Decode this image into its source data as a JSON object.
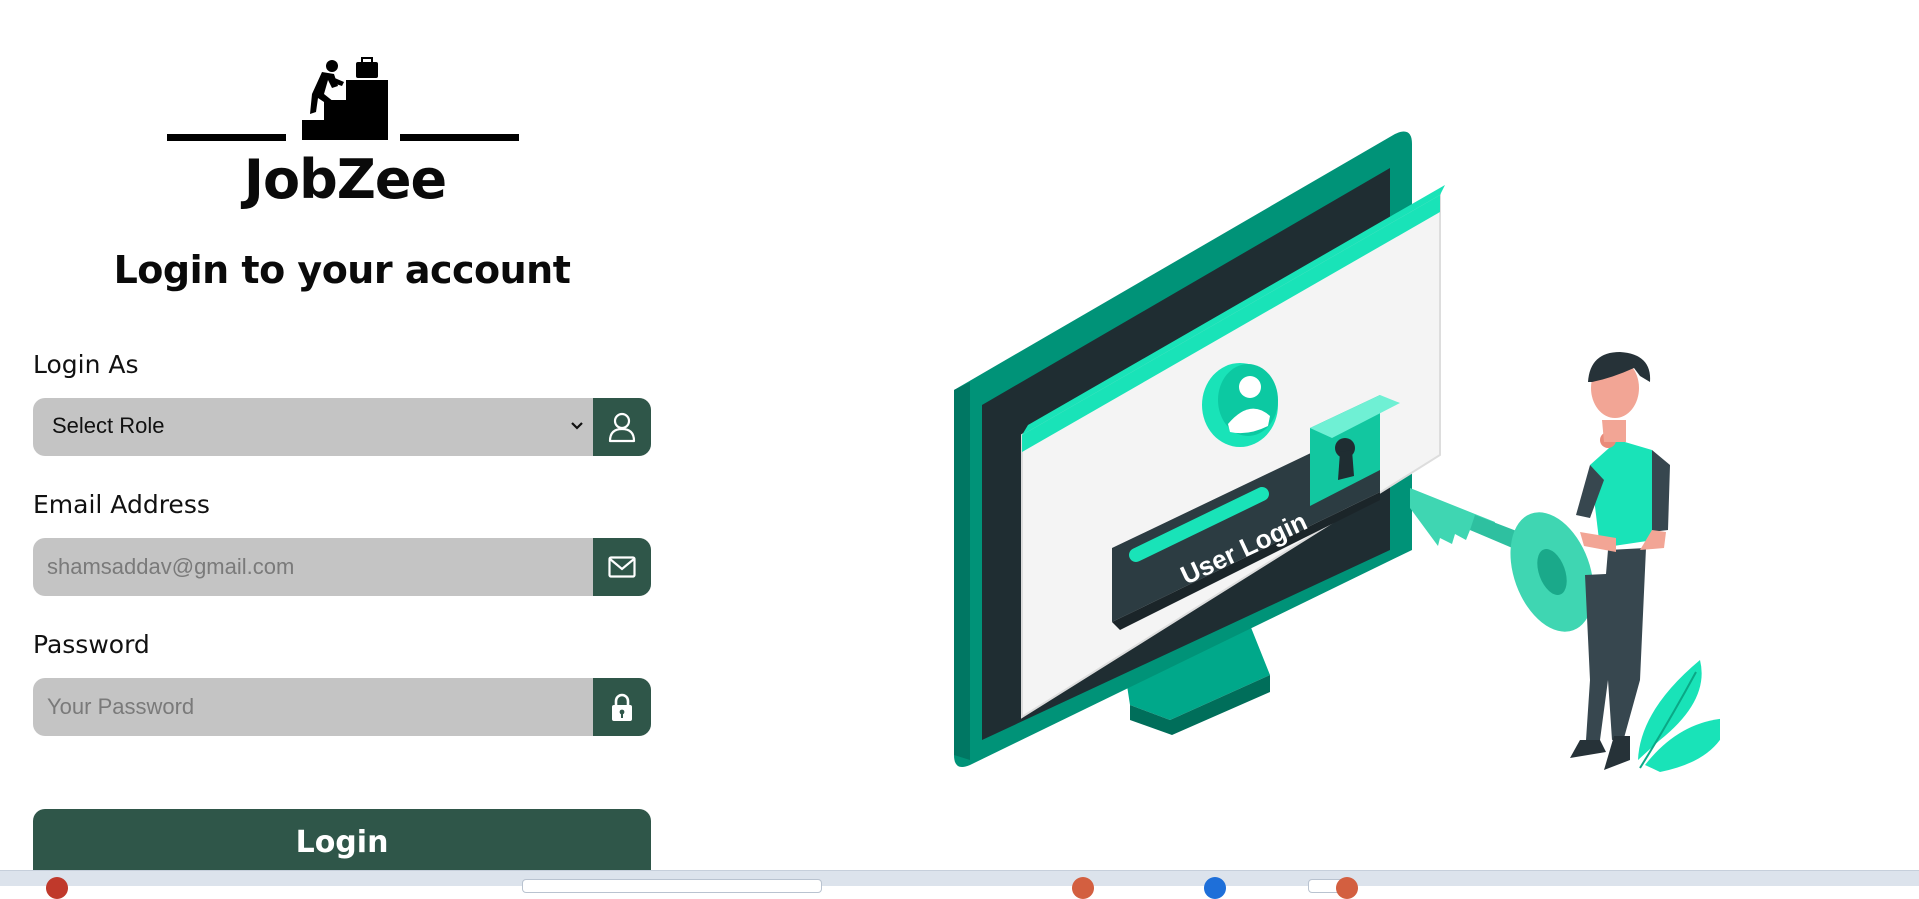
{
  "brand": {
    "name": "JobZee"
  },
  "login": {
    "title": "Login to your account",
    "role_label": "Login As",
    "role_select_value": "Select Role",
    "email_label": "Email Address",
    "email_placeholder": "shamsaddav@gmail.com",
    "password_label": "Password",
    "password_placeholder": "Your Password",
    "submit_label": "Login"
  },
  "illustration": {
    "button_text": "User Login"
  },
  "icons": {
    "role": "user-icon",
    "email": "mail-icon",
    "password": "lock-icon",
    "select": "chevron-down-icon"
  },
  "colors": {
    "accent": "#2f5649",
    "input_bg": "#c4c4c4",
    "illustration_teal": "#00d4a8",
    "illustration_dark_teal": "#009378"
  }
}
